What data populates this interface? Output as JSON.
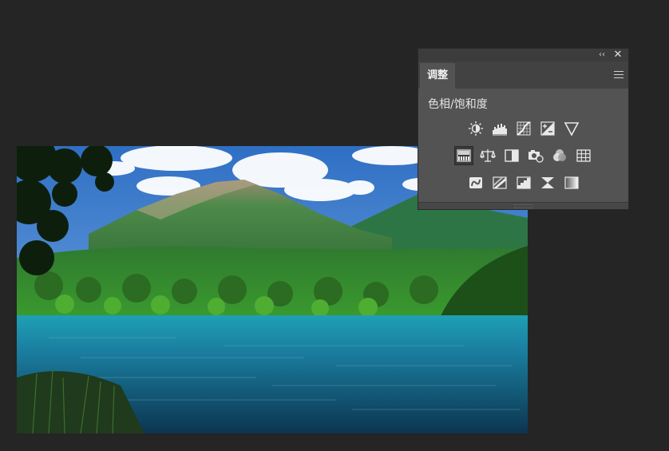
{
  "panel": {
    "tab_label": "调整",
    "mode_label": "色相/饱和度",
    "collapse_glyph": "‹‹",
    "close_glyph": "✕"
  },
  "icons": {
    "row1": [
      "brightness-contrast-icon",
      "levels-icon",
      "curves-icon",
      "exposure-icon",
      "vibrance-icon"
    ],
    "row2": [
      "hue-saturation-icon",
      "color-balance-icon",
      "black-white-icon",
      "photo-filter-icon",
      "channel-mixer-icon",
      "color-lookup-icon"
    ],
    "row3": [
      "invert-icon",
      "posterize-icon",
      "threshold-icon",
      "selective-color-icon",
      "gradient-map-icon"
    ],
    "selected": "hue-saturation-icon"
  },
  "colors": {
    "workspace": "#252525",
    "panel": "#535353",
    "panel_header": "#3c3c3c",
    "icon": "#e8e8e8"
  }
}
